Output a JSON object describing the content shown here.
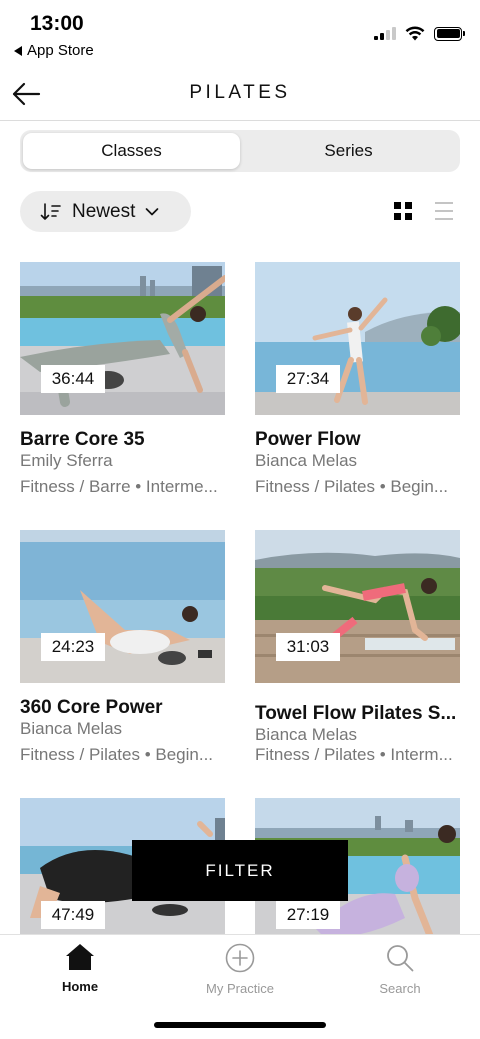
{
  "status_bar": {
    "time": "13:00",
    "back_app": "App Store"
  },
  "header": {
    "title": "PILATES",
    "back_icon": "arrow-left-icon"
  },
  "segments": {
    "classes": "Classes",
    "series": "Series",
    "selected": "Classes"
  },
  "sort": {
    "label": "Newest",
    "icon": "sort-descending-icon"
  },
  "view_toggle": {
    "active": "grid"
  },
  "cards": [
    {
      "title": "Barre Core 35",
      "instructor": "Emily Sferra",
      "meta": "Fitness / Barre • Interme...",
      "duration": "36:44"
    },
    {
      "title": "Power Flow",
      "instructor": "Bianca Melas",
      "meta": "Fitness / Pilates • Begin...",
      "duration": "27:34"
    },
    {
      "title": "360 Core Power",
      "instructor": "Bianca Melas",
      "meta": "Fitness / Pilates • Begin...",
      "duration": "24:23"
    },
    {
      "title": "Towel Flow Pilates S...",
      "instructor": "Bianca Melas",
      "meta": "Fitness / Pilates • Interm...",
      "duration": "31:03"
    },
    {
      "title": "",
      "instructor": "",
      "meta": "",
      "duration": "47:49"
    },
    {
      "title": "",
      "instructor": "",
      "meta": "",
      "duration": "27:19"
    }
  ],
  "filter": {
    "label": "FILTER"
  },
  "tabbar": {
    "home": "Home",
    "my_practice": "My Practice",
    "search": "Search",
    "active": "Home"
  },
  "colors": {
    "accent": "#000000",
    "muted_text": "#777777",
    "segment_bg": "#ececec"
  }
}
